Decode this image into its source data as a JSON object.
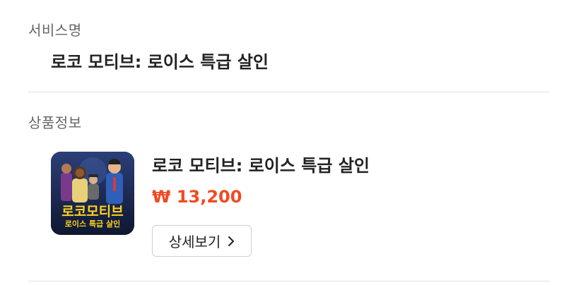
{
  "service": {
    "label": "서비스명",
    "name": "로코 모티브: 로이스 특급 살인"
  },
  "product": {
    "label": "상품정보",
    "name": "로코 모티브: 로이스 특급 살인",
    "price": "₩ 13,200",
    "thumbnail_title_line1": "로코모티브",
    "thumbnail_title_line2": "로이스 특급 살인",
    "detail_button_label": "상세보기",
    "detail_button_icon": "chevron-right-icon"
  },
  "colors": {
    "price": "#f04a23",
    "thumbnail_title": "#ffd21e",
    "divider": "#e2e2e2"
  }
}
